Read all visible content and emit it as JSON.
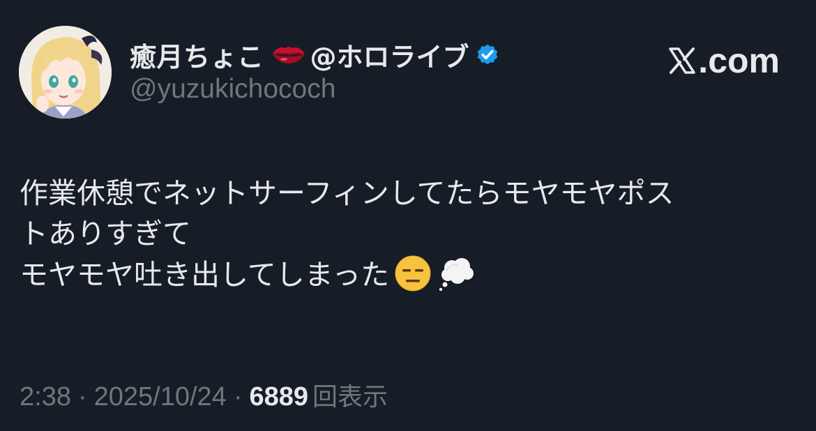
{
  "author": {
    "display_name": "癒月ちょこ",
    "name_emoji": "lips-emoji",
    "name_suffix": "@ホロライブ",
    "verified": true,
    "handle": "@yuzukichococh",
    "avatar": "avatar-image"
  },
  "brand": {
    "text": ".com",
    "logo": "x-logo-icon"
  },
  "tweet": {
    "lines": [
      "作業休憩でネットサーフィンしてたらモヤモヤポス",
      "トありすぎて",
      "モヤモヤ吐き出してしまった"
    ],
    "trailing_emojis": [
      "expressionless-face-emoji",
      "thought-balloon-emoji"
    ]
  },
  "meta": {
    "time": "2:38",
    "separator": "·",
    "date": "2025/10/24",
    "views_count": "6889",
    "views_label": "回表示"
  },
  "colors": {
    "background": "#161d27",
    "text_primary": "#e7e9ea",
    "text_secondary": "#71767b",
    "verified_blue": "#1d9bf0"
  }
}
